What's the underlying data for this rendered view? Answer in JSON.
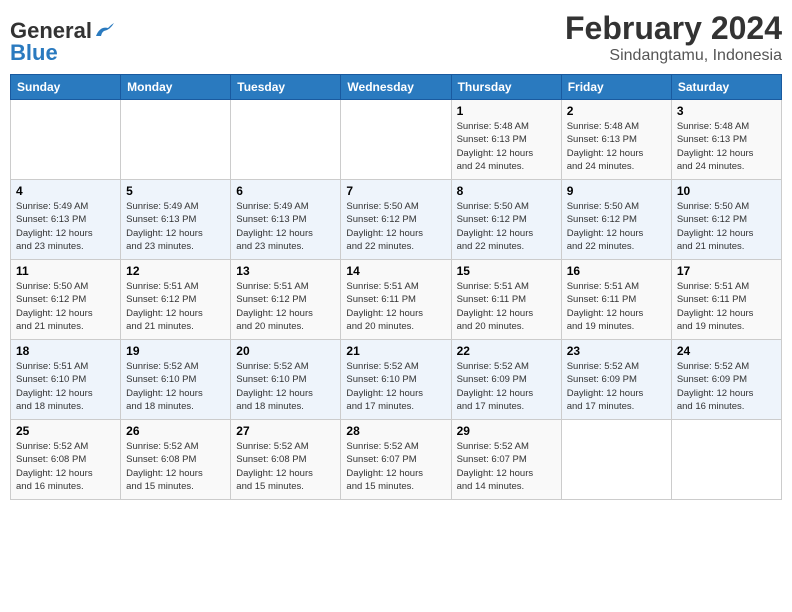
{
  "logo": {
    "line1": "General",
    "line2": "Blue"
  },
  "title": "February 2024",
  "subtitle": "Sindangtamu, Indonesia",
  "days_of_week": [
    "Sunday",
    "Monday",
    "Tuesday",
    "Wednesday",
    "Thursday",
    "Friday",
    "Saturday"
  ],
  "weeks": [
    [
      {
        "day": "",
        "detail": ""
      },
      {
        "day": "",
        "detail": ""
      },
      {
        "day": "",
        "detail": ""
      },
      {
        "day": "",
        "detail": ""
      },
      {
        "day": "1",
        "detail": "Sunrise: 5:48 AM\nSunset: 6:13 PM\nDaylight: 12 hours\nand 24 minutes."
      },
      {
        "day": "2",
        "detail": "Sunrise: 5:48 AM\nSunset: 6:13 PM\nDaylight: 12 hours\nand 24 minutes."
      },
      {
        "day": "3",
        "detail": "Sunrise: 5:48 AM\nSunset: 6:13 PM\nDaylight: 12 hours\nand 24 minutes."
      }
    ],
    [
      {
        "day": "4",
        "detail": "Sunrise: 5:49 AM\nSunset: 6:13 PM\nDaylight: 12 hours\nand 23 minutes."
      },
      {
        "day": "5",
        "detail": "Sunrise: 5:49 AM\nSunset: 6:13 PM\nDaylight: 12 hours\nand 23 minutes."
      },
      {
        "day": "6",
        "detail": "Sunrise: 5:49 AM\nSunset: 6:13 PM\nDaylight: 12 hours\nand 23 minutes."
      },
      {
        "day": "7",
        "detail": "Sunrise: 5:50 AM\nSunset: 6:12 PM\nDaylight: 12 hours\nand 22 minutes."
      },
      {
        "day": "8",
        "detail": "Sunrise: 5:50 AM\nSunset: 6:12 PM\nDaylight: 12 hours\nand 22 minutes."
      },
      {
        "day": "9",
        "detail": "Sunrise: 5:50 AM\nSunset: 6:12 PM\nDaylight: 12 hours\nand 22 minutes."
      },
      {
        "day": "10",
        "detail": "Sunrise: 5:50 AM\nSunset: 6:12 PM\nDaylight: 12 hours\nand 21 minutes."
      }
    ],
    [
      {
        "day": "11",
        "detail": "Sunrise: 5:50 AM\nSunset: 6:12 PM\nDaylight: 12 hours\nand 21 minutes."
      },
      {
        "day": "12",
        "detail": "Sunrise: 5:51 AM\nSunset: 6:12 PM\nDaylight: 12 hours\nand 21 minutes."
      },
      {
        "day": "13",
        "detail": "Sunrise: 5:51 AM\nSunset: 6:12 PM\nDaylight: 12 hours\nand 20 minutes."
      },
      {
        "day": "14",
        "detail": "Sunrise: 5:51 AM\nSunset: 6:11 PM\nDaylight: 12 hours\nand 20 minutes."
      },
      {
        "day": "15",
        "detail": "Sunrise: 5:51 AM\nSunset: 6:11 PM\nDaylight: 12 hours\nand 20 minutes."
      },
      {
        "day": "16",
        "detail": "Sunrise: 5:51 AM\nSunset: 6:11 PM\nDaylight: 12 hours\nand 19 minutes."
      },
      {
        "day": "17",
        "detail": "Sunrise: 5:51 AM\nSunset: 6:11 PM\nDaylight: 12 hours\nand 19 minutes."
      }
    ],
    [
      {
        "day": "18",
        "detail": "Sunrise: 5:51 AM\nSunset: 6:10 PM\nDaylight: 12 hours\nand 18 minutes."
      },
      {
        "day": "19",
        "detail": "Sunrise: 5:52 AM\nSunset: 6:10 PM\nDaylight: 12 hours\nand 18 minutes."
      },
      {
        "day": "20",
        "detail": "Sunrise: 5:52 AM\nSunset: 6:10 PM\nDaylight: 12 hours\nand 18 minutes."
      },
      {
        "day": "21",
        "detail": "Sunrise: 5:52 AM\nSunset: 6:10 PM\nDaylight: 12 hours\nand 17 minutes."
      },
      {
        "day": "22",
        "detail": "Sunrise: 5:52 AM\nSunset: 6:09 PM\nDaylight: 12 hours\nand 17 minutes."
      },
      {
        "day": "23",
        "detail": "Sunrise: 5:52 AM\nSunset: 6:09 PM\nDaylight: 12 hours\nand 17 minutes."
      },
      {
        "day": "24",
        "detail": "Sunrise: 5:52 AM\nSunset: 6:09 PM\nDaylight: 12 hours\nand 16 minutes."
      }
    ],
    [
      {
        "day": "25",
        "detail": "Sunrise: 5:52 AM\nSunset: 6:08 PM\nDaylight: 12 hours\nand 16 minutes."
      },
      {
        "day": "26",
        "detail": "Sunrise: 5:52 AM\nSunset: 6:08 PM\nDaylight: 12 hours\nand 15 minutes."
      },
      {
        "day": "27",
        "detail": "Sunrise: 5:52 AM\nSunset: 6:08 PM\nDaylight: 12 hours\nand 15 minutes."
      },
      {
        "day": "28",
        "detail": "Sunrise: 5:52 AM\nSunset: 6:07 PM\nDaylight: 12 hours\nand 15 minutes."
      },
      {
        "day": "29",
        "detail": "Sunrise: 5:52 AM\nSunset: 6:07 PM\nDaylight: 12 hours\nand 14 minutes."
      },
      {
        "day": "",
        "detail": ""
      },
      {
        "day": "",
        "detail": ""
      }
    ]
  ]
}
